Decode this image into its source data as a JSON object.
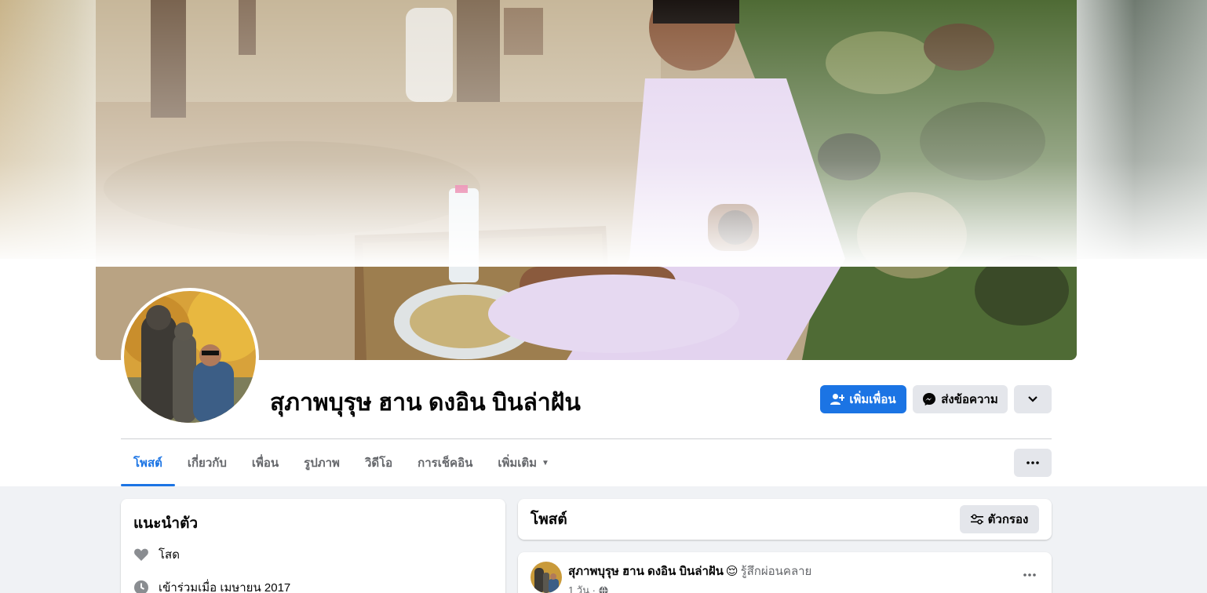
{
  "profile": {
    "name": "สุภาพบุรุษ ฮาน ดงอิน บินล่าฝัน"
  },
  "actions": {
    "add_friend": "เพิ่มเพื่อน",
    "message": "ส่งข้อความ"
  },
  "tabs": [
    {
      "label": "โพสต์"
    },
    {
      "label": "เกี่ยวกับ"
    },
    {
      "label": "เพื่อน"
    },
    {
      "label": "รูปภาพ"
    },
    {
      "label": "วิดีโอ"
    },
    {
      "label": "การเช็คอิน"
    },
    {
      "label": "เพิ่มเติม"
    }
  ],
  "intro": {
    "title": "แนะนำตัว",
    "relationship": "โสด",
    "joined": "เข้าร่วมเมื่อ เมษายน 2017"
  },
  "posts": {
    "title": "โพสต์",
    "filter_label": "ตัวกรอง"
  },
  "post": {
    "author": "สุภาพบุรุษ ฮาน ดงอิน บินล่าฝัน",
    "emoji": "😌",
    "feeling": "รู้สึกผ่อนคลาย",
    "time": "1 วัน ·"
  },
  "colors": {
    "accent": "#1b74e4",
    "secondary_button": "#e4e6eb",
    "background": "#f0f2f5"
  },
  "icons": {
    "add_friend": "person-add-icon",
    "message": "messenger-icon",
    "more": "chevron-down-icon",
    "tabs_more": "ellipsis-icon",
    "relationship": "heart-icon",
    "joined": "clock-icon",
    "filter": "sliders-icon",
    "privacy": "globe-icon"
  }
}
